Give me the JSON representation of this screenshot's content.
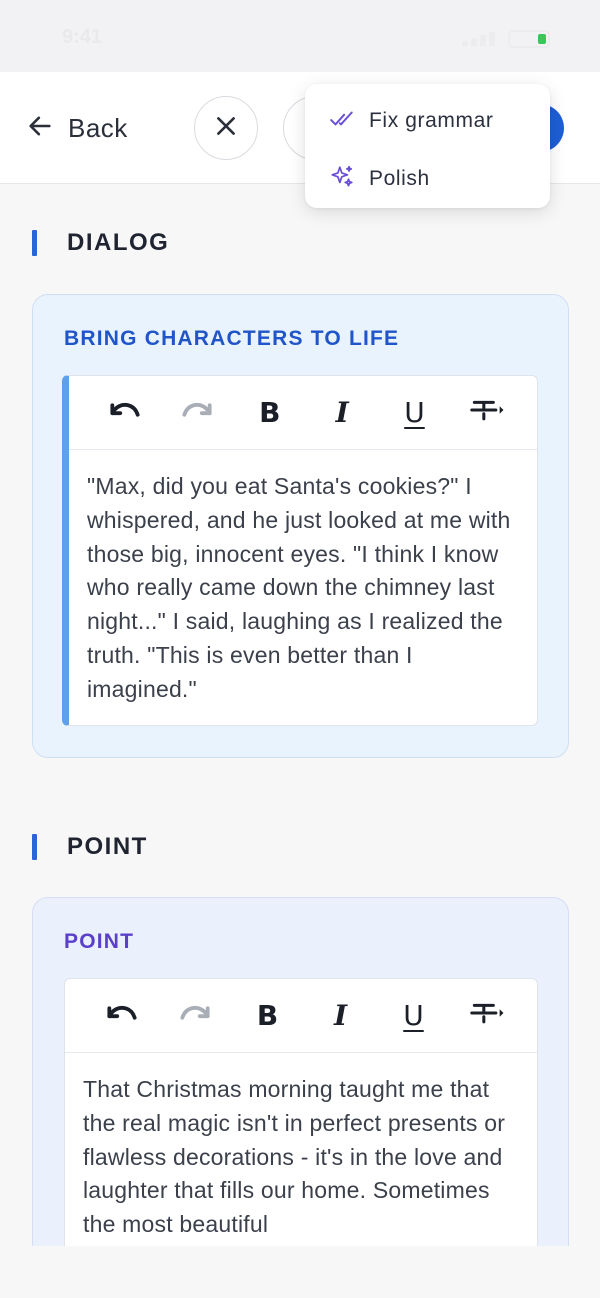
{
  "status_bar": {
    "time": "9:41"
  },
  "header": {
    "back_label": "Back"
  },
  "dropdown": {
    "items": [
      {
        "label": "Fix grammar",
        "icon": "double-check-icon"
      },
      {
        "label": "Polish",
        "icon": "sparkle-icon"
      }
    ]
  },
  "sections": [
    {
      "title": "DIALOG",
      "card_label": "BRING CHARACTERS TO LIFE",
      "text": "\"Max, did you eat Santa's cookies?\" I whispered, and he just looked at me with those big, innocent eyes. \"I think I know who really came down the chimney last night...\" I said, laughing as I realized the truth. \"This is even better than I imagined.\""
    },
    {
      "title": "POINT",
      "card_label": "POINT",
      "text": "That Christmas morning taught me that the real magic isn't in perfect presents or flawless decorations - it's in the love and laughter that fills our home. Sometimes the most beautiful"
    }
  ],
  "toolbar": {
    "bold": "B",
    "italic": "I",
    "underline": "U"
  },
  "colors": {
    "accent": "#1d5fd6",
    "section_bar": "#2d63d9",
    "dialog_label": "#1f55c8",
    "point_label": "#5a3fc9"
  }
}
